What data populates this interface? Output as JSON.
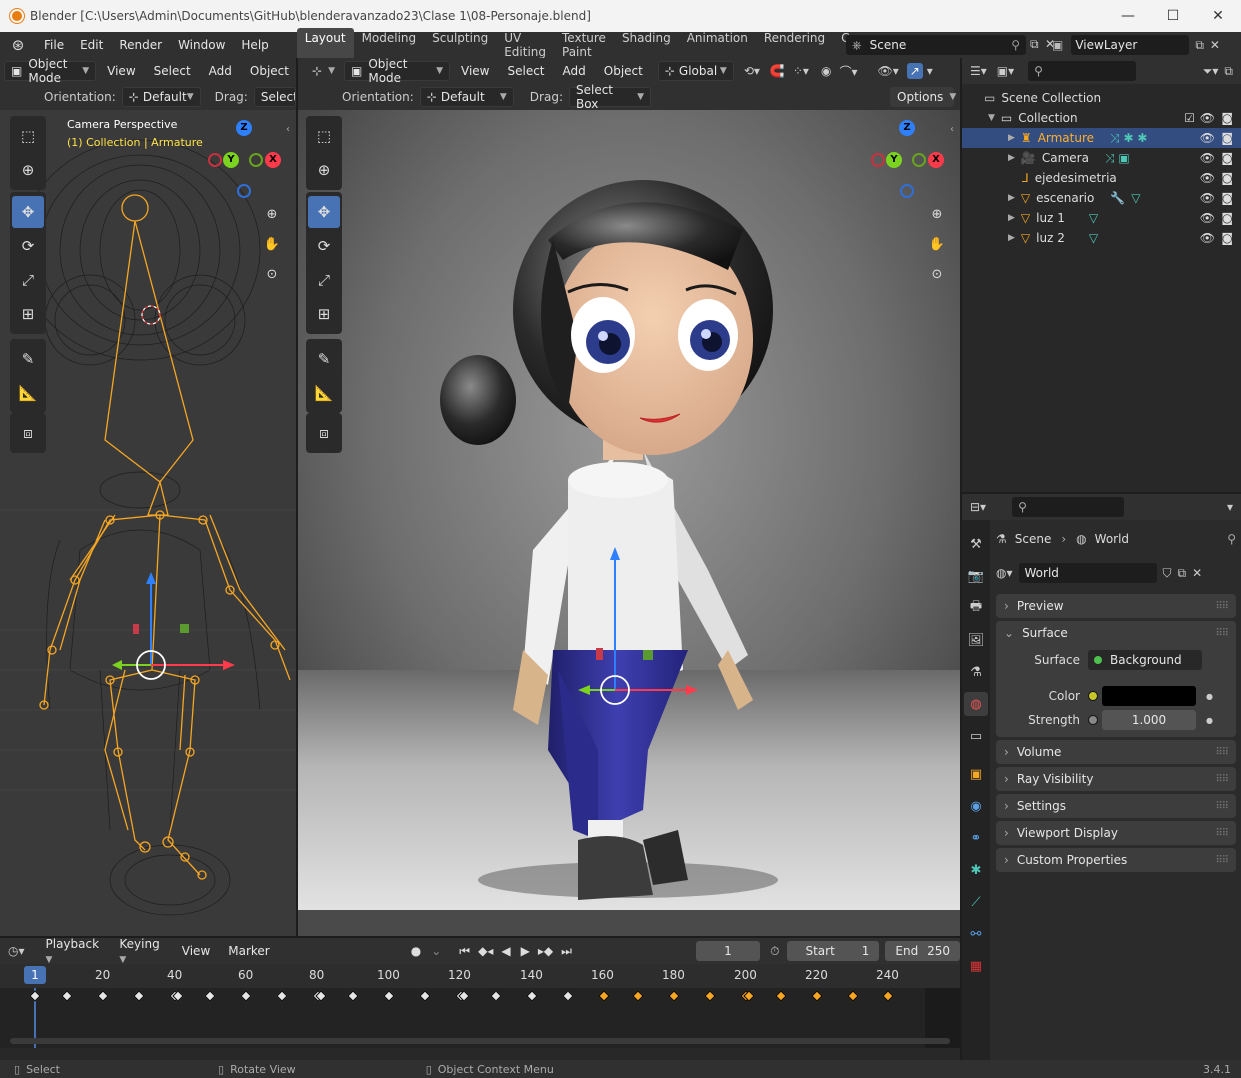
{
  "window": {
    "title": "Blender [C:\\Users\\Admin\\Documents\\GitHub\\blenderavanzado23\\Clase 1\\08-Personaje.blend]",
    "minimize": "—",
    "maximize": "☐",
    "close": "✕"
  },
  "menu": {
    "file": "File",
    "edit": "Edit",
    "render": "Render",
    "window": "Window",
    "help": "Help"
  },
  "workspaces": [
    "Layout",
    "Modeling",
    "Sculpting",
    "UV Editing",
    "Texture Paint",
    "Shading",
    "Animation",
    "Rendering",
    "Compo"
  ],
  "scene": {
    "label": "Scene"
  },
  "viewlayer": {
    "label": "ViewLayer"
  },
  "left_view": {
    "mode": "Object Mode",
    "menus": [
      "View",
      "Select",
      "Add",
      "Object"
    ],
    "orientation_label": "Orientation:",
    "orientation_value": "Default",
    "drag_label": "Drag:",
    "drag_value": "Select",
    "overlay_title": "Camera Perspective",
    "overlay_sub": "(1) Collection | Armature"
  },
  "main_view": {
    "mode": "Object Mode",
    "menus": [
      "View",
      "Select",
      "Add",
      "Object"
    ],
    "transform": "Global",
    "orientation_label": "Orientation:",
    "orientation_value": "Default",
    "drag_label": "Drag:",
    "drag_value": "Select Box",
    "options": "Options"
  },
  "gizmo": {
    "z": "Z",
    "y": "Y",
    "x": "X"
  },
  "outliner": {
    "scene_collection": "Scene Collection",
    "collection": "Collection",
    "items": [
      {
        "name": "Armature",
        "selected": true
      },
      {
        "name": "Camera"
      },
      {
        "name": "ejedesimetria"
      },
      {
        "name": "escenario"
      },
      {
        "name": "luz 1"
      },
      {
        "name": "luz 2"
      }
    ]
  },
  "properties": {
    "breadcrumb_scene": "Scene",
    "breadcrumb_world": "World",
    "world_name": "World",
    "panels": {
      "preview": "Preview",
      "surface": "Surface",
      "volume": "Volume",
      "ray_visibility": "Ray Visibility",
      "settings": "Settings",
      "viewport_display": "Viewport Display",
      "custom_properties": "Custom Properties"
    },
    "surface_label": "Surface",
    "surface_value": "Background",
    "color_label": "Color",
    "color_value": "#000000",
    "strength_label": "Strength",
    "strength_value": "1.000"
  },
  "timeline": {
    "menus": {
      "playback": "Playback",
      "keying": "Keying",
      "view": "View",
      "marker": "Marker"
    },
    "current_frame": "1",
    "start_label": "Start",
    "start_value": "1",
    "end_label": "End",
    "end_value": "250",
    "ruler": [
      "1",
      "20",
      "40",
      "60",
      "80",
      "100",
      "120",
      "140",
      "160",
      "180",
      "200",
      "220",
      "240"
    ]
  },
  "status": {
    "select": "Select",
    "rotate": "Rotate View",
    "context": "Object Context Menu",
    "version": "3.4.1"
  },
  "colors": {
    "accent": "#4772b3",
    "armature": "#f5a623",
    "selected_text": "#ffaf29",
    "overlay_yellow": "#ffe24a"
  }
}
